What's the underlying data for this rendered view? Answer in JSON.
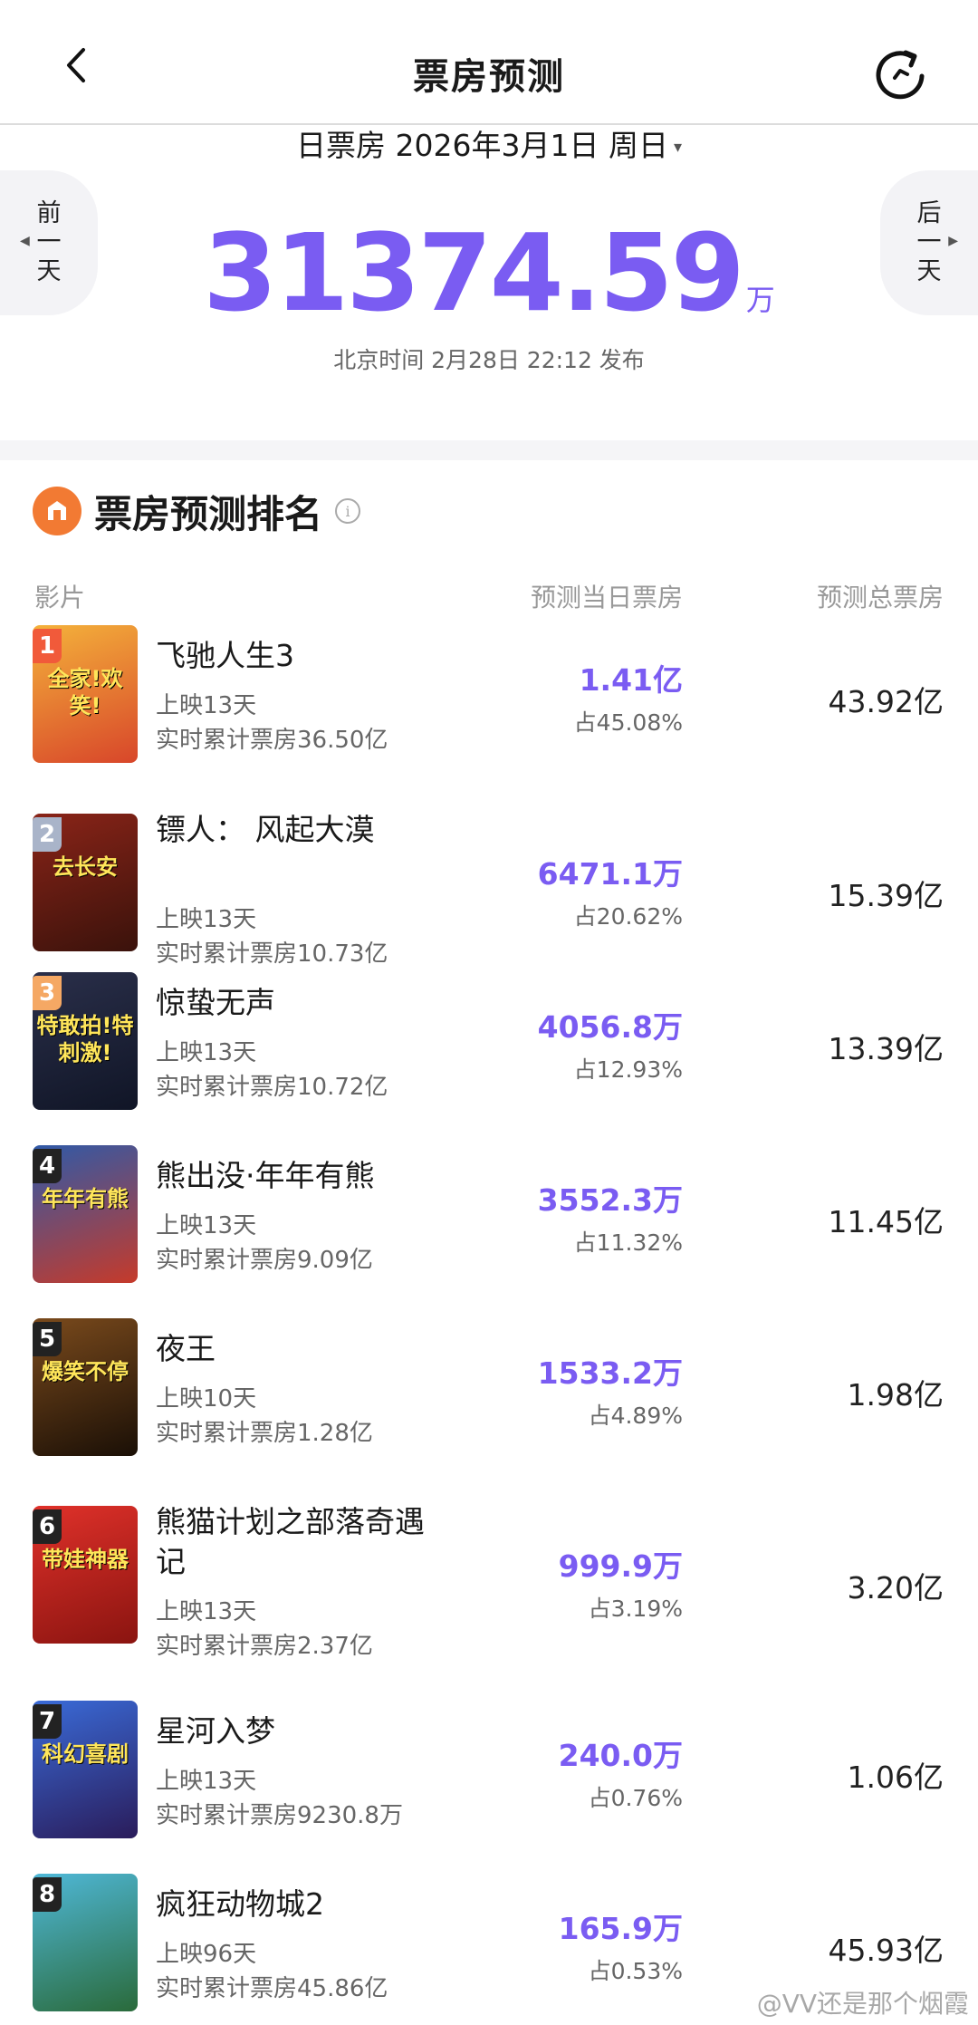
{
  "header": {
    "title": "票房预测",
    "back_icon": "chevron-left-icon",
    "refresh_icon": "refresh-icon"
  },
  "date_bar": {
    "label": "日票房  2026年3月1日  周日",
    "caret": "▾"
  },
  "nav": {
    "prev_label": [
      "前",
      "一",
      "天"
    ],
    "next_label": [
      "后",
      "一",
      "天"
    ]
  },
  "summary": {
    "value": "31374.59",
    "unit": "万",
    "published": "北京时间  2月28日  22:12  发布"
  },
  "ranking": {
    "title": "票房预测排名",
    "columns": {
      "film": "影片",
      "day": "预测当日票房",
      "total": "预测总票房"
    },
    "rows": [
      {
        "rank": "1",
        "name": "飞驰人生3",
        "days": "上映13天",
        "cum": "实时累计票房36.50亿",
        "day": "1.41亿",
        "share": "占45.08%",
        "total": "43.92亿",
        "badge_color": "#f15a3a",
        "poster_colors": [
          "#f4b23b",
          "#d8462a"
        ],
        "poster_text": "全家!欢笑!"
      },
      {
        "rank": "2",
        "name": "镖人：  风起大漠",
        "days": "上映13天",
        "cum": "实时累计票房10.73亿",
        "day": "6471.1万",
        "share": "占20.62%",
        "total": "15.39亿",
        "badge_color": "#a9b4c9",
        "poster_colors": [
          "#8a2418",
          "#3a120b"
        ],
        "poster_text": "去长安"
      },
      {
        "rank": "3",
        "name": "惊蛰无声",
        "days": "上映13天",
        "cum": "实时累计票房10.72亿",
        "day": "4056.8万",
        "share": "占12.93%",
        "total": "13.39亿",
        "badge_color": "#f5a864",
        "poster_colors": [
          "#2a2f4a",
          "#101526"
        ],
        "poster_text": "特敢拍!特刺激!"
      },
      {
        "rank": "4",
        "name": "熊出没·年年有熊",
        "days": "上映13天",
        "cum": "实时累计票房9.09亿",
        "day": "3552.3万",
        "share": "占11.32%",
        "total": "11.45亿",
        "badge_color": "#222222",
        "poster_colors": [
          "#2f5aa8",
          "#c63a2a"
        ],
        "poster_text": "年年有熊"
      },
      {
        "rank": "5",
        "name": "夜王",
        "days": "上映10天",
        "cum": "实时累计票房1.28亿",
        "day": "1533.2万",
        "share": "占4.89%",
        "total": "1.98亿",
        "badge_color": "#222222",
        "poster_colors": [
          "#7a4a1c",
          "#1a0f06"
        ],
        "poster_text": "爆笑不停"
      },
      {
        "rank": "6",
        "name": "熊猫计划之部落奇遇记",
        "days": "上映13天",
        "cum": "实时累计票房2.37亿",
        "day": "999.9万",
        "share": "占3.19%",
        "total": "3.20亿",
        "badge_color": "#222222",
        "poster_colors": [
          "#e0312a",
          "#8a1410"
        ],
        "poster_text": "带娃神器"
      },
      {
        "rank": "7",
        "name": "星河入梦",
        "days": "上映13天",
        "cum": "实时累计票房9230.8万",
        "day": "240.0万",
        "share": "占0.76%",
        "total": "1.06亿",
        "badge_color": "#222222",
        "poster_colors": [
          "#3a6bd8",
          "#2a1c5a"
        ],
        "poster_text": "科幻喜剧"
      },
      {
        "rank": "8",
        "name": "疯狂动物城2",
        "days": "上映96天",
        "cum": "实时累计票房45.86亿",
        "day": "165.9万",
        "share": "占0.53%",
        "total": "45.93亿",
        "badge_color": "#222222",
        "poster_colors": [
          "#4fb8d8",
          "#2a6a3a"
        ],
        "poster_text": ""
      }
    ]
  },
  "watermark": "@VV还是那个烟霞"
}
